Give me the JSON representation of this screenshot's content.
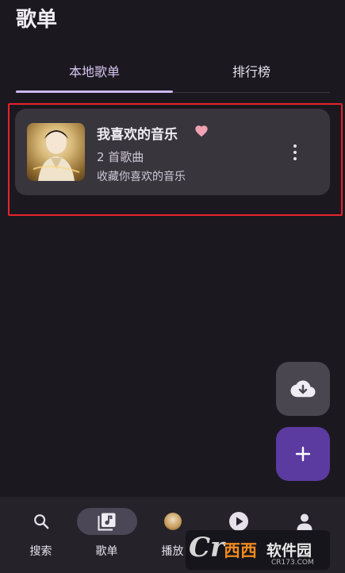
{
  "header": {
    "title": "歌单"
  },
  "tabs": [
    {
      "label": "本地歌单",
      "selected": true
    },
    {
      "label": "排行榜",
      "selected": false
    }
  ],
  "playlist": {
    "title": "我喜欢的音乐",
    "count": "2 首歌曲",
    "description": "收藏你喜欢的音乐",
    "cover": "album-cover-image",
    "badge_icon": "heart-icon",
    "badge_color": "#f2a3b3"
  },
  "fabs": {
    "download_icon": "cloud-download-icon",
    "add_icon": "plus-icon",
    "add_color": "#5b3ba0"
  },
  "bottom_nav": [
    {
      "label": "搜索",
      "icon": "search-icon",
      "active": false
    },
    {
      "label": "歌单",
      "icon": "playlist-icon",
      "active": true
    },
    {
      "label": "播放",
      "icon": "now-playing-avatar",
      "active": false
    },
    {
      "label": "",
      "icon": "play-circle-icon",
      "active": false
    },
    {
      "label": "",
      "icon": "person-icon",
      "active": false
    }
  ],
  "watermark": {
    "logo": "Cr",
    "brand": "西西",
    "text": "软件园",
    "url": "CR173.COM"
  },
  "colors": {
    "background": "#1b1820",
    "accent": "#cbb8f2",
    "card": "#38353d",
    "highlight": "#e8232a"
  }
}
